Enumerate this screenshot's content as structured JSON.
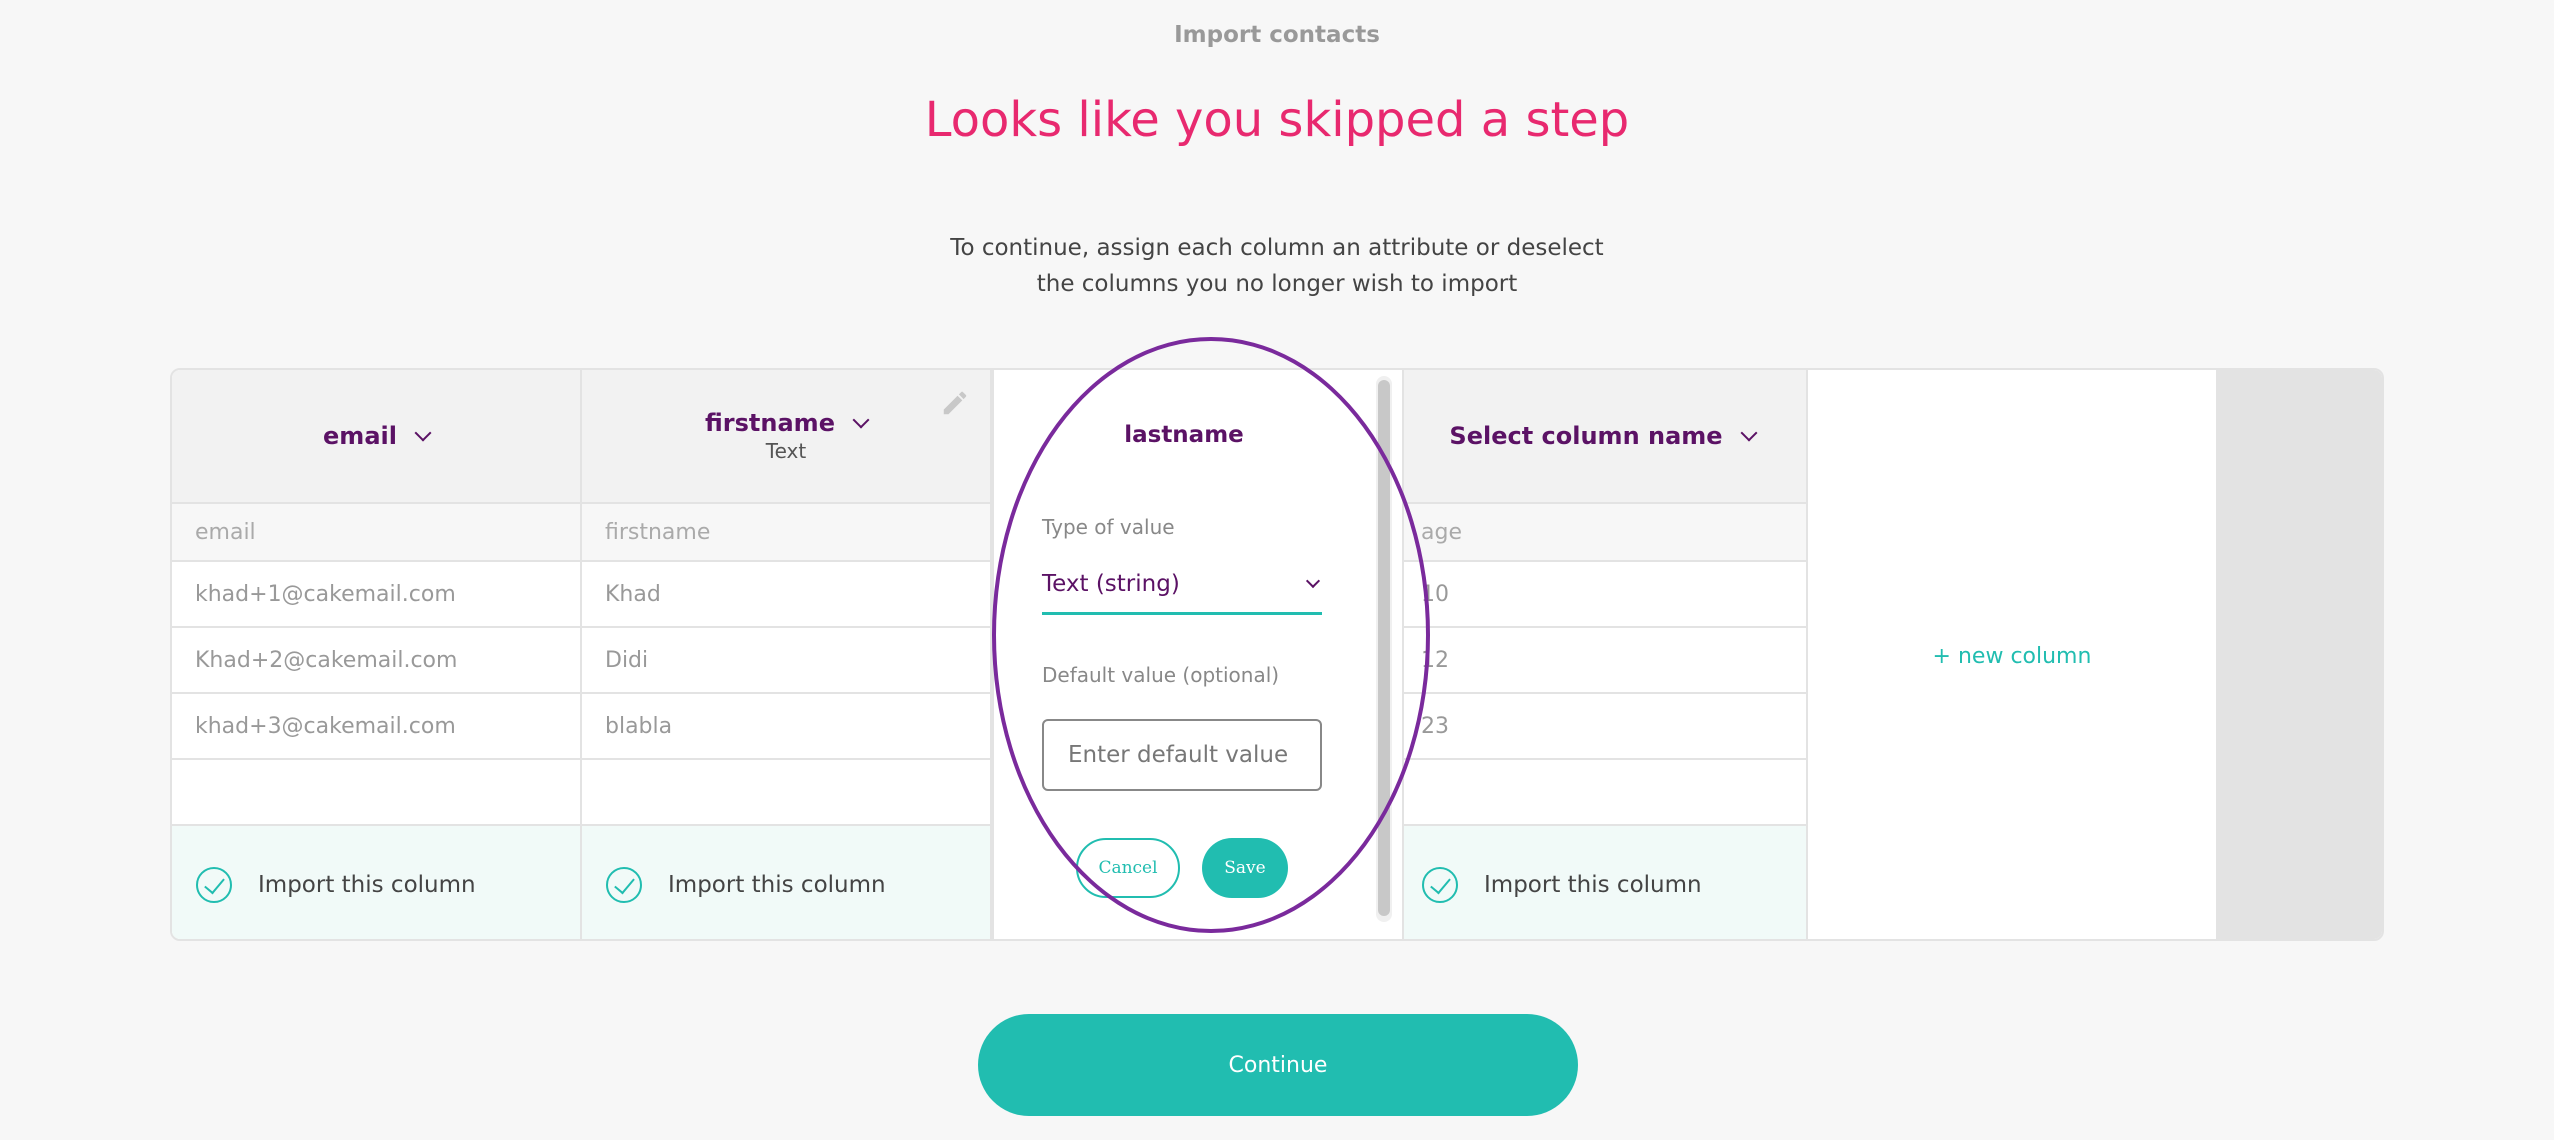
{
  "header": {
    "breadcrumb": "Import contacts",
    "headline": "Looks like you skipped a step",
    "instructions_line1": "To continue, assign each column an attribute or deselect",
    "instructions_line2": "the columns you no longer wish to import"
  },
  "columns": [
    {
      "mapped_name": "email",
      "subtitle": "",
      "source_header": "email",
      "values": [
        "khad+1@cakemail.com",
        "Khad+2@cakemail.com",
        "khad+3@cakemail.com",
        ""
      ],
      "import_label": "Import this column"
    },
    {
      "mapped_name": "firstname",
      "subtitle": "Text",
      "source_header": "firstname",
      "values": [
        "Khad",
        "Didi",
        "blabla",
        ""
      ],
      "import_label": "Import this column"
    },
    {
      "mapped_name": "Select column name",
      "subtitle": "",
      "source_header": "age",
      "values": [
        "10",
        "12",
        "23",
        ""
      ],
      "import_label": "Import this column"
    }
  ],
  "popover": {
    "title": "lastname",
    "type_label": "Type of value",
    "type_value": "Text (string)",
    "default_label": "Default value (optional)",
    "default_placeholder": "Enter default value",
    "cancel_label": "Cancel",
    "save_label": "Save"
  },
  "new_column_label": "+ new column",
  "continue_label": "Continue",
  "colors": {
    "accent": "#21bdb0",
    "headline": "#e8296f",
    "brand_purple": "#5b1265",
    "annotation": "#7a2a9c"
  },
  "icons": [
    "chevron-down-icon",
    "pencil-icon",
    "check-circle-icon"
  ]
}
